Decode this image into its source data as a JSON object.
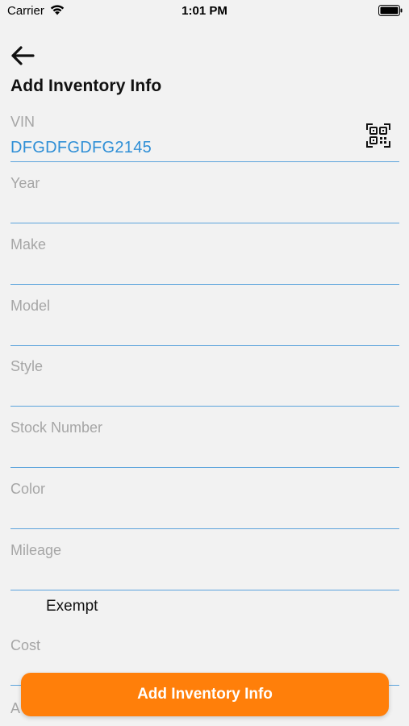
{
  "status_bar": {
    "carrier": "Carrier",
    "time": "1:01 PM"
  },
  "header": {
    "back_icon": "arrow-left-icon",
    "title": "Add Inventory Info"
  },
  "form": {
    "vin": {
      "label": "VIN",
      "value": "DFGDFGDFG2145",
      "scan_icon": "qr-scan-icon"
    },
    "year": {
      "label": "Year",
      "value": ""
    },
    "make": {
      "label": "Make",
      "value": ""
    },
    "model": {
      "label": "Model",
      "value": ""
    },
    "style": {
      "label": "Style",
      "value": ""
    },
    "stock_number": {
      "label": "Stock Number",
      "value": ""
    },
    "color": {
      "label": "Color",
      "value": ""
    },
    "mileage": {
      "label": "Mileage",
      "value": ""
    },
    "exempt": {
      "label": "Exempt"
    },
    "cost": {
      "label": "Cost",
      "value": ""
    },
    "next_partial_label": "A"
  },
  "submit": {
    "label": "Add Inventory Info"
  },
  "colors": {
    "accent": "#ff7f0a",
    "underline": "#5ba3dc",
    "value_text": "#2f8fd6",
    "label_text": "#a6a6a6"
  }
}
